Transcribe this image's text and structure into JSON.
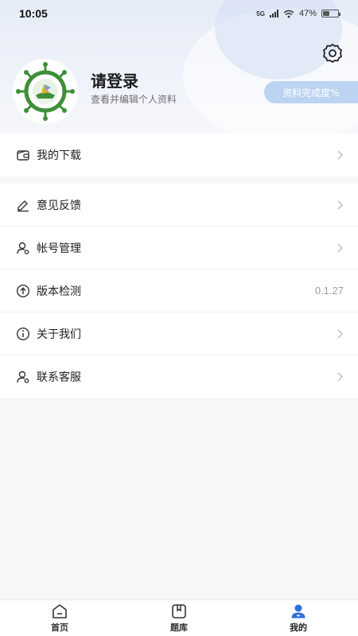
{
  "status_bar": {
    "time": "10:05",
    "network": "5G",
    "battery": "47%",
    "battery_level": 0.47
  },
  "header": {
    "title": "请登录",
    "subtitle": "查看并编辑个人资料",
    "profile_button": "资料完成度%",
    "settings_icon": "gear-icon"
  },
  "menu_group1": [
    {
      "label": "我的下载",
      "icon": "wallet-icon"
    }
  ],
  "menu_group2": [
    {
      "label": "意见反馈",
      "icon": "edit-icon"
    },
    {
      "label": "帐号管理",
      "icon": "user-icon"
    },
    {
      "label": "版本检测",
      "icon": "upload-icon",
      "value": "0.1.27"
    },
    {
      "label": "关于我们",
      "icon": "info-icon"
    },
    {
      "label": "联系客服",
      "icon": "user-icon"
    }
  ],
  "tabbar": [
    {
      "label": "首页",
      "icon": "home-icon"
    },
    {
      "label": "题库",
      "icon": "bookmark-icon"
    },
    {
      "label": "我的",
      "icon": "profile-icon",
      "active": true
    }
  ],
  "colors": {
    "accent": "#2f6fe0",
    "profile_button_bg": "#bcd3f2"
  }
}
